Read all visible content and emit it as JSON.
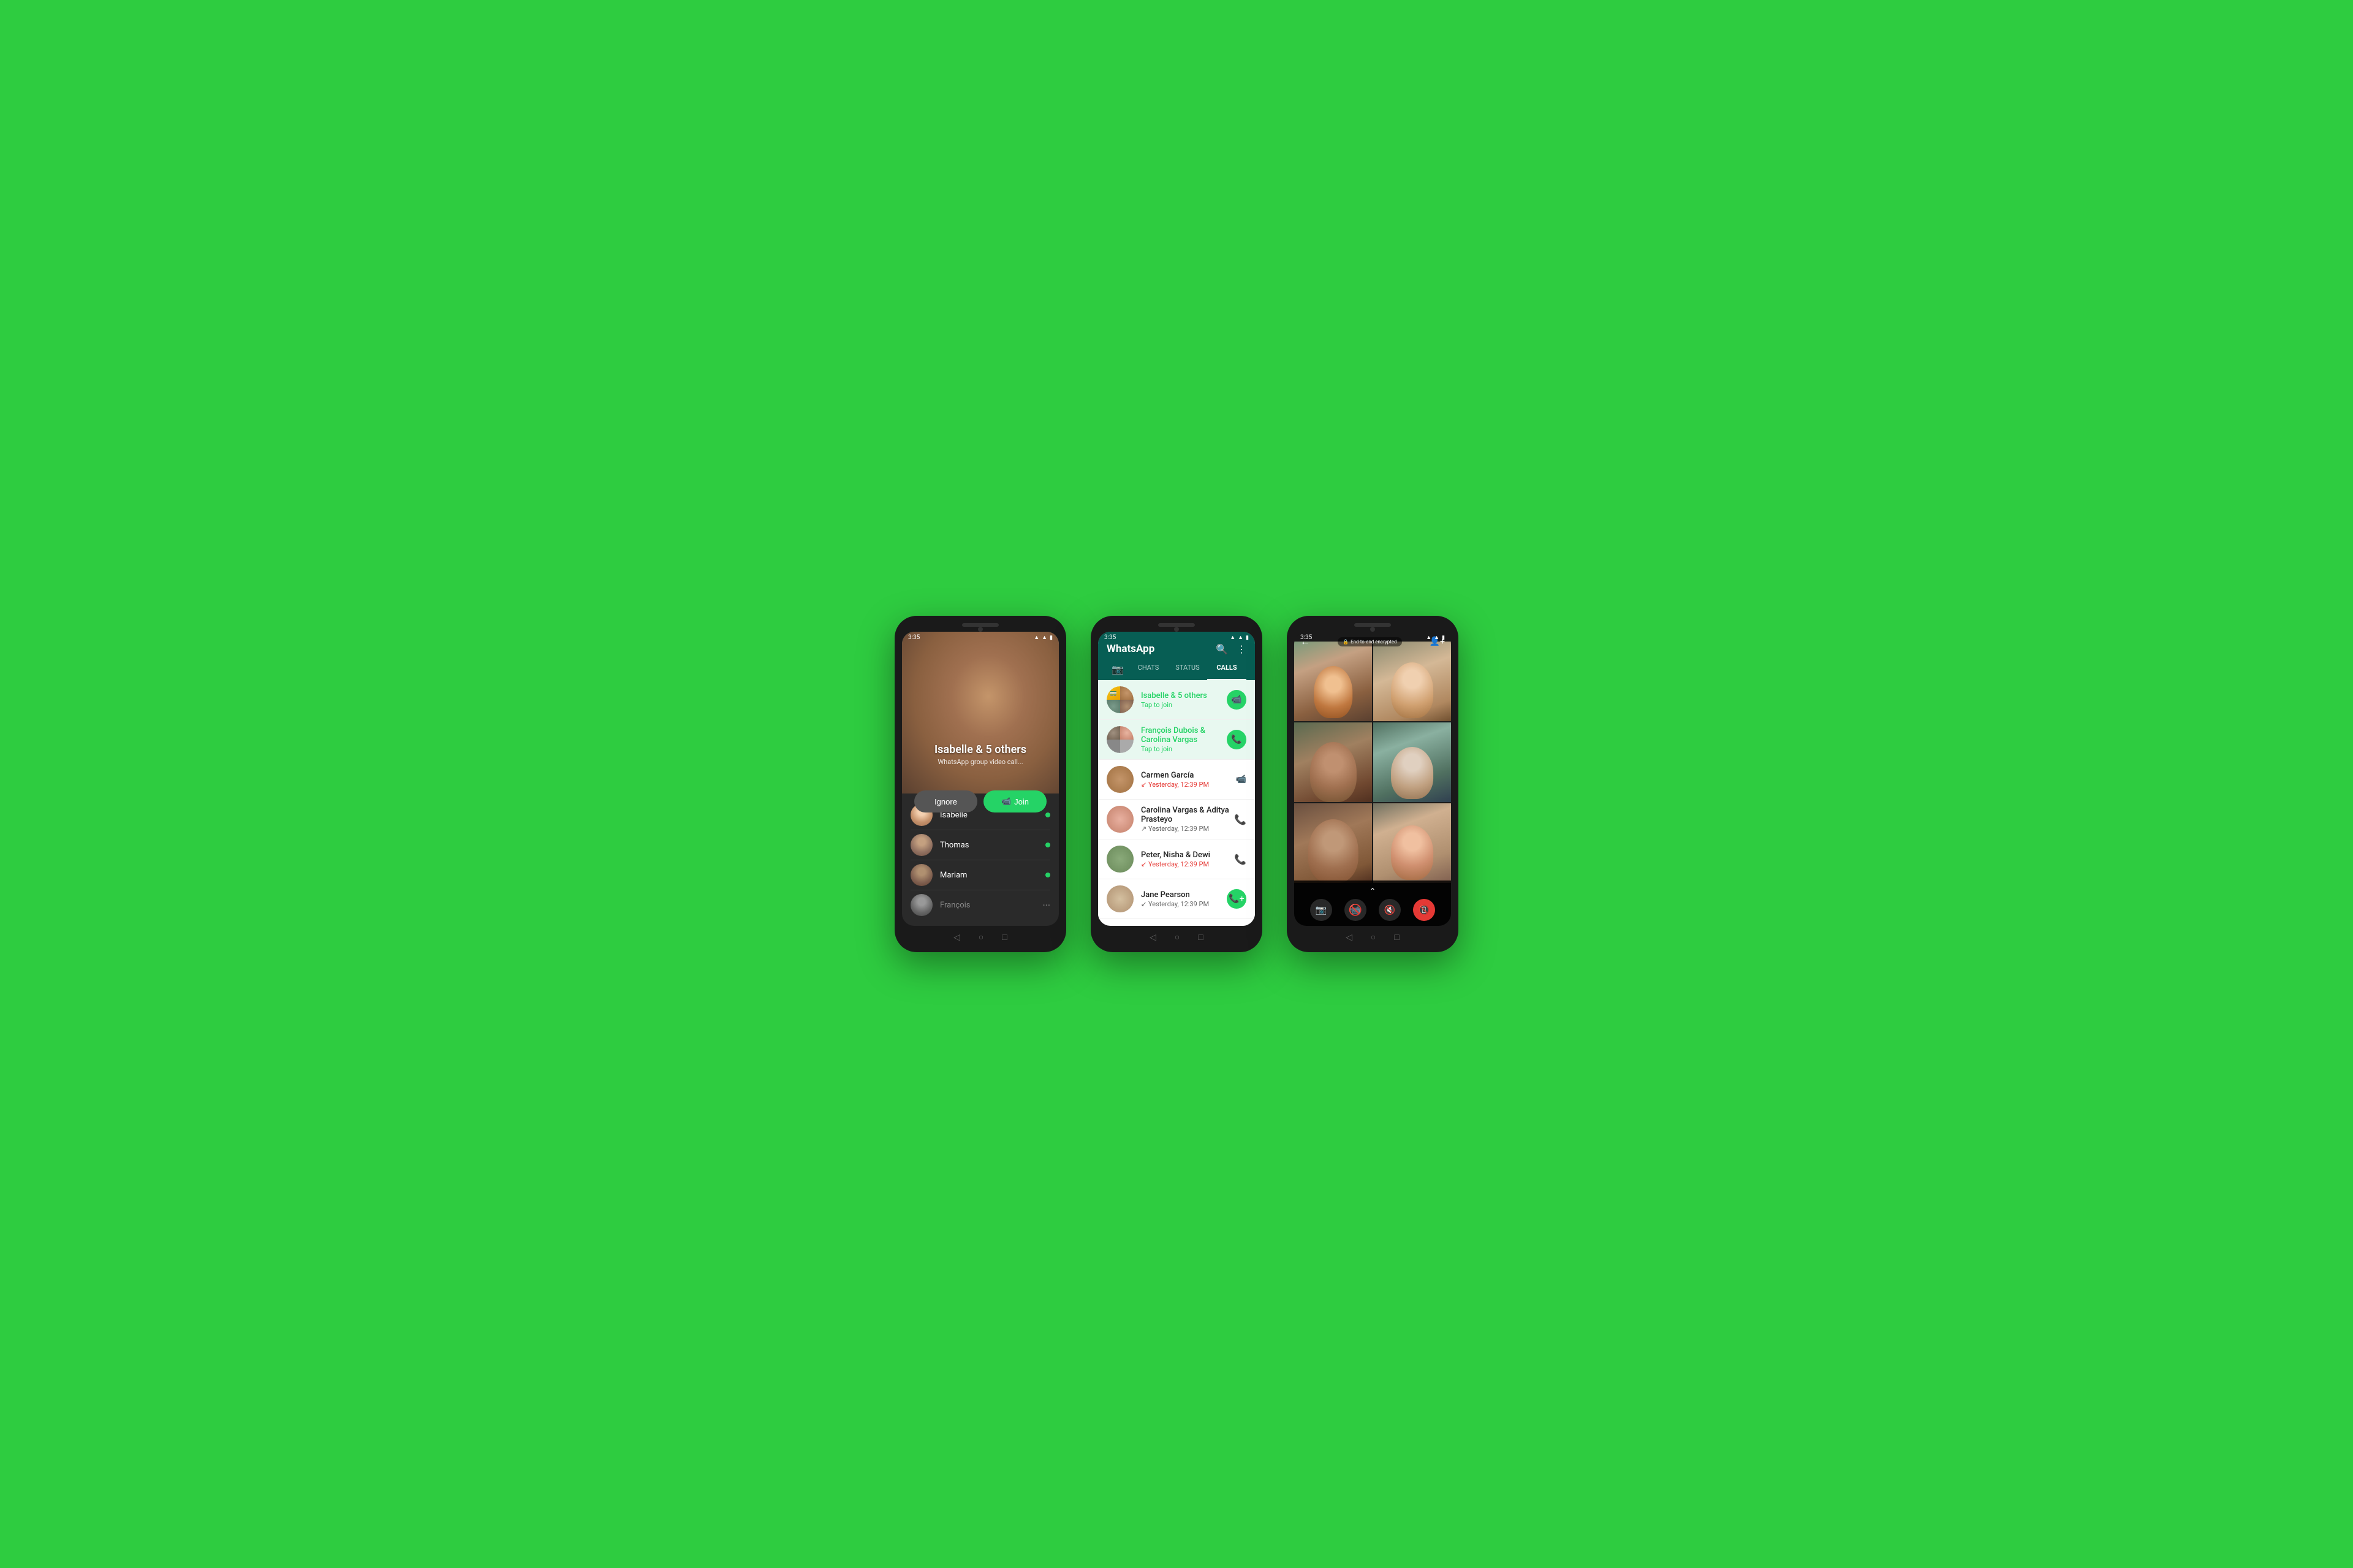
{
  "background": "#2ecc40",
  "phone1": {
    "status_time": "3:35",
    "call_title": "Isabelle & 5 others",
    "call_subtitle": "WhatsApp group video call...",
    "ignore_label": "Ignore",
    "join_label": "Join",
    "participants": [
      {
        "name": "Isabelle",
        "online": true,
        "avatar_class": "av-isabelle"
      },
      {
        "name": "Thomas",
        "online": true,
        "avatar_class": "av-thomas"
      },
      {
        "name": "Mariam",
        "online": true,
        "avatar_class": "av-mariam"
      },
      {
        "name": "François",
        "online": false,
        "avatar_class": "av-francois"
      }
    ]
  },
  "phone2": {
    "status_time": "3:35",
    "app_title": "WhatsApp",
    "tabs": [
      {
        "label": "📷",
        "active": false
      },
      {
        "label": "CHATS",
        "active": false
      },
      {
        "label": "STATUS",
        "active": false
      },
      {
        "label": "CALLS",
        "active": true
      }
    ],
    "active_calls": [
      {
        "name": "Isabelle & 5 others",
        "subtitle": "Tap to join",
        "type": "video",
        "active": true
      },
      {
        "name": "François Dubois & Carolina Vargas",
        "subtitle": "Tap to join",
        "type": "phone",
        "active": true
      }
    ],
    "recent_calls": [
      {
        "name": "Carmen García",
        "subtitle": "Yesterday, 12:39 PM",
        "type": "video",
        "direction": "missed"
      },
      {
        "name": "Carolina Vargas & Aditya Prasteyo",
        "subtitle": "Yesterday, 12:39 PM",
        "type": "phone",
        "direction": "outgoing"
      },
      {
        "name": "Peter, Nisha & Dewi",
        "subtitle": "Yesterday, 12:39 PM",
        "type": "phone",
        "direction": "missed"
      },
      {
        "name": "Jane Pearson",
        "subtitle": "Yesterday, 12:39 PM",
        "type": "add",
        "direction": "incoming"
      }
    ]
  },
  "phone3": {
    "status_time": "3:35",
    "encrypt_label": "End-to-end encrypted",
    "participants_count": 6,
    "controls": [
      "camera",
      "video-off",
      "mute",
      "end-call"
    ]
  }
}
